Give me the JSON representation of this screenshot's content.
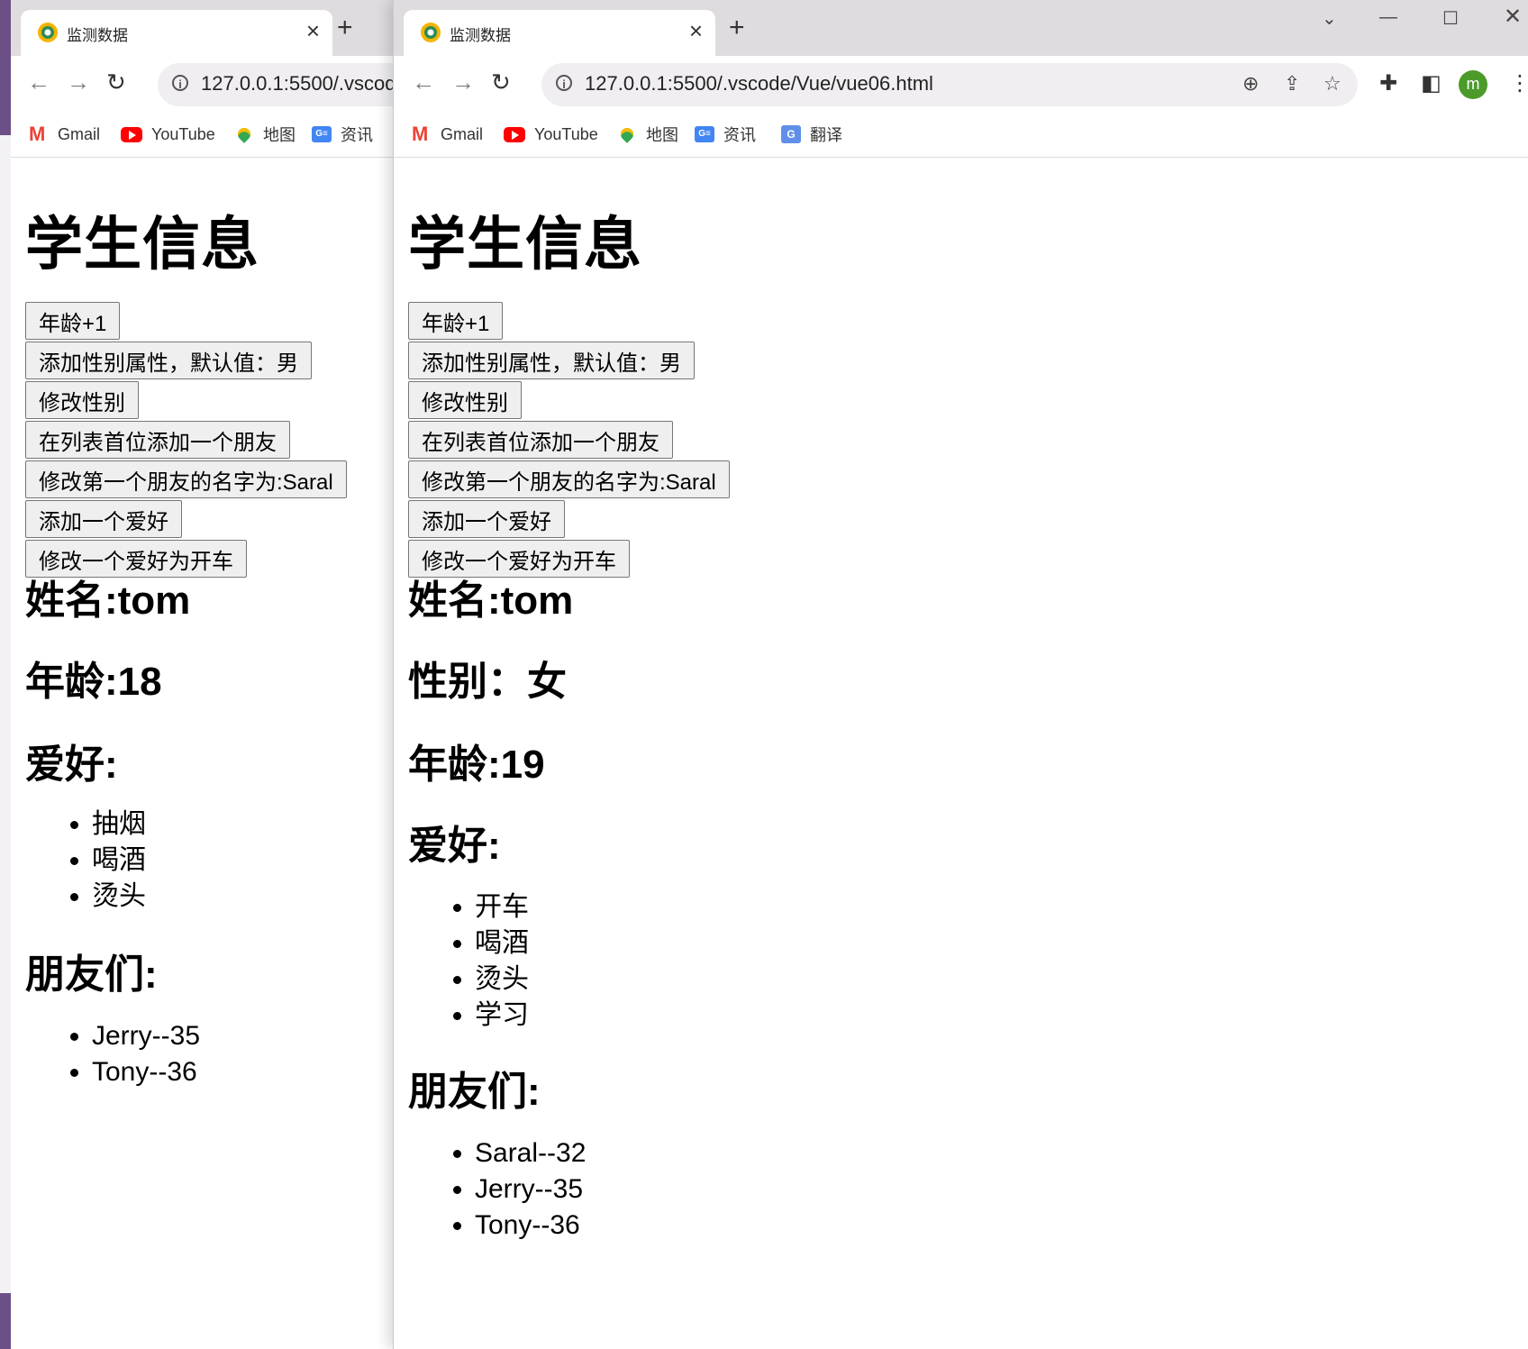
{
  "browser": {
    "tab_title": "监测数据",
    "new_tab_symbol": "+",
    "url_front": "127.0.0.1:5500/.vscode/Vue/vue06.html",
    "url_back": "127.0.0.1:5500/.vscod",
    "avatar_letter": "m",
    "accent_color": "#4b9a2a",
    "bookmarks": [
      {
        "label": "Gmail",
        "icon": "gmail-icon"
      },
      {
        "label": "YouTube",
        "icon": "youtube-icon"
      },
      {
        "label": "地图",
        "icon": "maps-icon"
      },
      {
        "label": "资讯",
        "icon": "news-icon"
      },
      {
        "label": "翻译",
        "icon": "translate-icon"
      }
    ],
    "back_bookmark_truncated": "资讯"
  },
  "page": {
    "title": "学生信息",
    "buttons": [
      "年龄+1",
      "添加性别属性，默认值：男",
      "修改性别",
      "在列表首位添加一个朋友",
      "修改第一个朋友的名字为:Saral",
      "添加一个爱好",
      "修改一个爱好为开车"
    ],
    "hobbies_heading": "爱好:",
    "friends_heading": "朋友们:"
  },
  "back_window": {
    "name_line": "姓名:tom",
    "age_line": "年龄:18",
    "hobbies": [
      "抽烟",
      "喝酒",
      "烫头"
    ],
    "friends": [
      "Jerry--35",
      "Tony--36"
    ]
  },
  "front_window": {
    "name_line": "姓名:tom",
    "gender_line": "性别：女",
    "age_line": "年龄:19",
    "hobbies": [
      "开车",
      "喝酒",
      "烫头",
      "学习"
    ],
    "friends": [
      "Saral--32",
      "Jerry--35",
      "Tony--36"
    ]
  }
}
